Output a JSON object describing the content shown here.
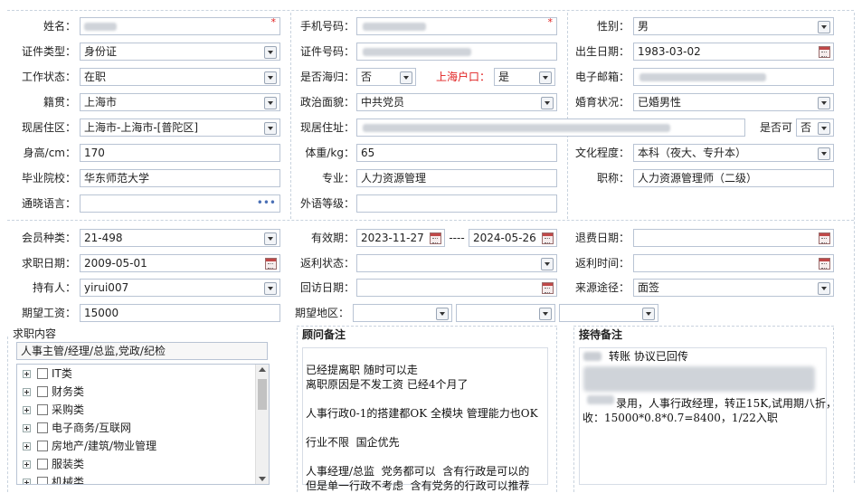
{
  "personal": {
    "name": {
      "label": "姓名：",
      "required": "*"
    },
    "phone": {
      "label": "手机号码：",
      "required": "*"
    },
    "gender": {
      "label": "性别：",
      "value": "男"
    },
    "id_type": {
      "label": "证件类型：",
      "value": "身份证"
    },
    "id_number": {
      "label": "证件号码："
    },
    "birth_date": {
      "label": "出生日期：",
      "value": "1983-03-02"
    },
    "work_status": {
      "label": "工作状态：",
      "value": "在职"
    },
    "returnee": {
      "label": "是否海归：",
      "value": "否"
    },
    "shanghai_hukou": {
      "label": "上海户口：",
      "value": "是"
    },
    "email": {
      "label": "电子邮箱："
    },
    "native_place": {
      "label": "籍贯：",
      "value": "上海市"
    },
    "political": {
      "label": "政治面貌：",
      "value": "中共党员"
    },
    "marital": {
      "label": "婚育状况：",
      "value": "已婚男性"
    },
    "current_area": {
      "label": "现居住区：",
      "value": "上海市-上海市-[普陀区]"
    },
    "current_address": {
      "label": "现居住址："
    },
    "is_ok": {
      "label": "是否可",
      "value": "否"
    },
    "height": {
      "label": "身高/cm：",
      "value": "170"
    },
    "weight": {
      "label": "体重/kg：",
      "value": "65"
    },
    "education": {
      "label": "文化程度：",
      "value": "本科（夜大、专升本）"
    },
    "school": {
      "label": "毕业院校：",
      "value": "华东师范大学"
    },
    "major": {
      "label": "专业：",
      "value": "人力资源管理"
    },
    "title": {
      "label": "职称：",
      "value": "人力资源管理师（二级）"
    },
    "language": {
      "label": "通晓语言：",
      "value": "",
      "more": "•••"
    },
    "foreign_level": {
      "label": "外语等级：",
      "value": ""
    }
  },
  "membership": {
    "member_type": {
      "label": "会员种类：",
      "value": "21-498"
    },
    "validity": {
      "label": "有效期：",
      "start": "2023-11-27",
      "sep": "----",
      "end": "2024-05-26"
    },
    "refund_date": {
      "label": "退费日期：",
      "value": ""
    },
    "job_date": {
      "label": "求职日期：",
      "value": "2009-05-01"
    },
    "rebate_status": {
      "label": "返利状态：",
      "value": ""
    },
    "rebate_time": {
      "label": "返利时间：",
      "value": ""
    },
    "holder": {
      "label": "持有人：",
      "value": "yirui007"
    },
    "visit_date": {
      "label": "回访日期：",
      "value": ""
    },
    "source": {
      "label": "来源途径：",
      "value": "面签"
    },
    "expected_salary": {
      "label": "期望工资：",
      "value": "15000"
    },
    "expected_area": {
      "label": "期望地区：",
      "value1": "",
      "value2": "",
      "value3": ""
    }
  },
  "job_content": {
    "title": "求职内容",
    "selected": "人事主管/经理/总监,党政/纪检",
    "tree": [
      "IT类",
      "财务类",
      "采购类",
      "电子商务/互联网",
      "房地产/建筑/物业管理",
      "服装类",
      "机械类"
    ]
  },
  "consultant_note": {
    "title": "顾问备注",
    "text": "已经提离职 随时可以走\n离职原因是不发工资 已经4个月了\n\n人事行政0-1的搭建都OK 全模块 管理能力也OK\n\n行业不限  国企优先\n\n人事经理/总监  党务都可以  含有行政是可以的\n但是单一行政不考虑  含有党务的行政可以推荐"
  },
  "reception_note": {
    "title": "接待备注",
    "line1": "转账 协议已回传",
    "line2": "录用，人事行政经理，转正15K,试用期八折，",
    "line3": "收：15000*0.8*0.7=8400，1/22入职"
  }
}
